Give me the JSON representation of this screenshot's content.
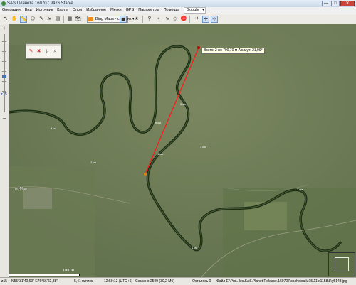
{
  "window": {
    "title": "SAS.Планета 160707.9476 Stable",
    "controls": {
      "minimize": "—",
      "maximize": "□",
      "close": "✕"
    }
  },
  "menubar": {
    "items": [
      "Операции",
      "Вид",
      "Источник",
      "Карты",
      "Слои",
      "Избранное",
      "Метки",
      "GPS",
      "Параметры",
      "Помощь"
    ],
    "search_combo": "Google"
  },
  "toolbar": {
    "map_source_label": "Bing Maps - спутник",
    "icons": [
      "select-cursor-icon",
      "drag-hand-icon",
      "zoom-region-icon",
      "measure-ruler-icon",
      "polygon-icon",
      "path-icon",
      "export-icon",
      "layers-icon",
      "star-icon",
      "goto-icon",
      "marker-icon",
      "add-point-icon",
      "add-path-icon",
      "add-polygon-icon",
      "go-icon",
      "stop-icon",
      "gps-icon",
      "crosshair-icon",
      "center-icon"
    ]
  },
  "left_panel": {
    "zoom_in": "+",
    "zoom_out": "−",
    "zoom_level": "z15"
  },
  "map": {
    "measure_label": "Всего: 2 км 790,70 м Азимут: 21,99°",
    "place_label": "ит-Мал",
    "km_marks": [
      "8 км",
      "7 км",
      "6 км",
      "5 км",
      "4 км",
      "3 км",
      "2 км",
      "1 км"
    ],
    "scale_label": "1000 м",
    "colors": {
      "river": "#213019",
      "measure_line": "#ff1a1a",
      "terrain": "#72805c"
    }
  },
  "measure_toolbar": {
    "icons": [
      "edit-path-icon",
      "delete-path-icon",
      "save-path-icon",
      "zoom-to-path-icon"
    ]
  },
  "statusbar": {
    "zoom": "z15",
    "coords": "N55°31'40,69\" E76°56'22,88\"",
    "scale": "5,41 м/пикс.",
    "time": "12:59:12 (UTC+6)",
    "downloaded": "Скачано 2599 (30,2 Мб)",
    "remaining": "Осталось 0",
    "file": "Файл E:\\Pro...les\\SAS.Planet Release.160707\\cache\\sat\\z15\\11\\x1158\\8\\y5143.jpg"
  }
}
